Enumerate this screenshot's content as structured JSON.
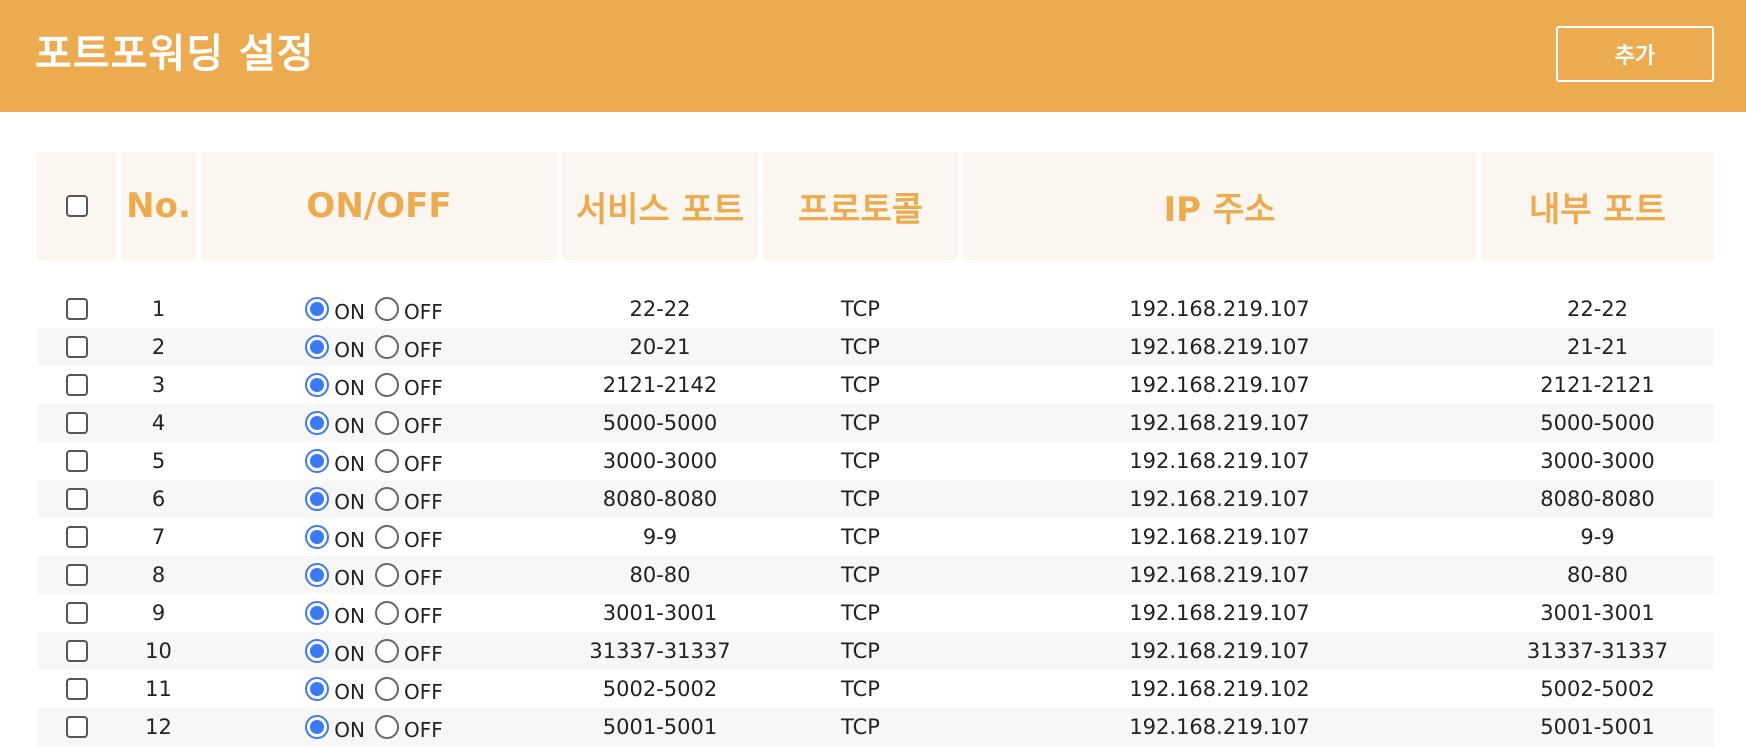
{
  "header": {
    "title": "포트포워딩 설정",
    "add_label": "추가"
  },
  "table": {
    "columns": [
      "No.",
      "ON/OFF",
      "서비스 포트",
      "프로토콜",
      "IP 주소",
      "내부 포트"
    ],
    "on_label": "ON",
    "off_label": "OFF",
    "rows": [
      {
        "no": "1",
        "state": "on",
        "service_port": "22-22",
        "protocol": "TCP",
        "ip": "192.168.219.107",
        "internal_port": "22-22"
      },
      {
        "no": "2",
        "state": "on",
        "service_port": "20-21",
        "protocol": "TCP",
        "ip": "192.168.219.107",
        "internal_port": "21-21"
      },
      {
        "no": "3",
        "state": "on",
        "service_port": "2121-2142",
        "protocol": "TCP",
        "ip": "192.168.219.107",
        "internal_port": "2121-2121"
      },
      {
        "no": "4",
        "state": "on",
        "service_port": "5000-5000",
        "protocol": "TCP",
        "ip": "192.168.219.107",
        "internal_port": "5000-5000"
      },
      {
        "no": "5",
        "state": "on",
        "service_port": "3000-3000",
        "protocol": "TCP",
        "ip": "192.168.219.107",
        "internal_port": "3000-3000"
      },
      {
        "no": "6",
        "state": "on",
        "service_port": "8080-8080",
        "protocol": "TCP",
        "ip": "192.168.219.107",
        "internal_port": "8080-8080"
      },
      {
        "no": "7",
        "state": "on",
        "service_port": "9-9",
        "protocol": "TCP",
        "ip": "192.168.219.107",
        "internal_port": "9-9"
      },
      {
        "no": "8",
        "state": "on",
        "service_port": "80-80",
        "protocol": "TCP",
        "ip": "192.168.219.107",
        "internal_port": "80-80"
      },
      {
        "no": "9",
        "state": "on",
        "service_port": "3001-3001",
        "protocol": "TCP",
        "ip": "192.168.219.107",
        "internal_port": "3001-3001"
      },
      {
        "no": "10",
        "state": "on",
        "service_port": "31337-31337",
        "protocol": "TCP",
        "ip": "192.168.219.107",
        "internal_port": "31337-31337"
      },
      {
        "no": "11",
        "state": "on",
        "service_port": "5002-5002",
        "protocol": "TCP",
        "ip": "192.168.219.102",
        "internal_port": "5002-5002"
      },
      {
        "no": "12",
        "state": "on",
        "service_port": "5001-5001",
        "protocol": "TCP",
        "ip": "192.168.219.107",
        "internal_port": "5001-5001"
      }
    ]
  },
  "colors": {
    "accent": "#edab4f",
    "header_cell_bg": "#fbf7f0",
    "radio_selected": "#3b7af5"
  },
  "icons": {
    "checkbox": "checkbox-icon",
    "radio": "radio-icon"
  }
}
